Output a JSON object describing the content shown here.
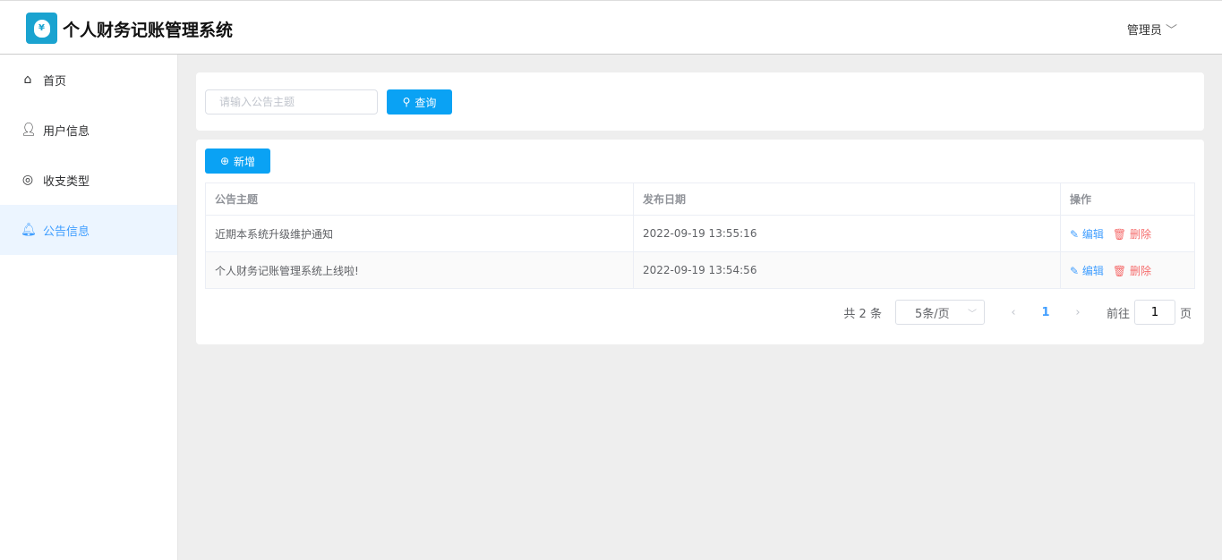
{
  "app": {
    "title": "个人财务记账管理系统",
    "user": "管理员",
    "logo_symbol": "¥"
  },
  "sidebar": {
    "items": [
      {
        "label": "首页",
        "icon": "home-icon"
      },
      {
        "label": "用户信息",
        "icon": "user-icon"
      },
      {
        "label": "收支类型",
        "icon": "lifebuoy-icon"
      },
      {
        "label": "公告信息",
        "icon": "bell-icon"
      }
    ]
  },
  "search": {
    "placeholder": "请输入公告主题",
    "value": "",
    "button": "查询"
  },
  "toolbar": {
    "add": "新增"
  },
  "table": {
    "headers": [
      "公告主题",
      "发布日期",
      "操作"
    ],
    "rows": [
      {
        "title": "近期本系统升级维护通知",
        "date": "2022-09-19 13:55:16"
      },
      {
        "title": "个人财务记账管理系统上线啦!",
        "date": "2022-09-19 13:54:56"
      }
    ],
    "edit": "编辑",
    "delete": "删除"
  },
  "pagination": {
    "total": "共 2 条",
    "page_size": "5条/页",
    "current": "1",
    "goto": "前往",
    "goto_value": "1",
    "page_suffix": "页"
  }
}
